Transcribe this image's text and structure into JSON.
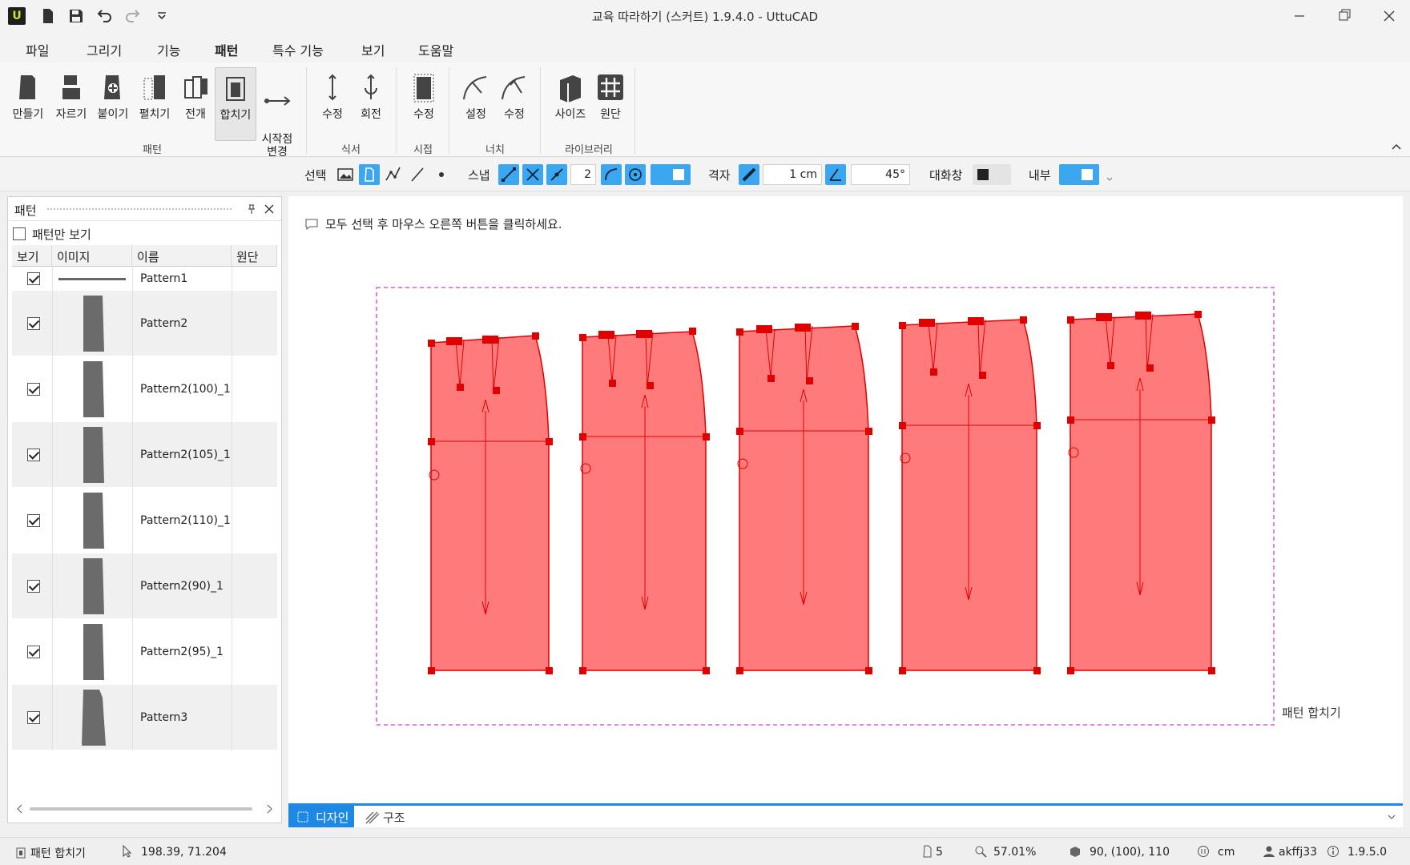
{
  "app": {
    "title": "교육 따라하기 (스커트) 1.9.4.0 - UttuCAD",
    "logo": "U"
  },
  "menu": [
    "파일",
    "그리기",
    "기능",
    "패턴",
    "특수 기능",
    "보기",
    "도움말"
  ],
  "ribbon": {
    "buttons": [
      "만들기",
      "자르기",
      "붙이기",
      "펼치기",
      "전개",
      "합치기",
      "시작점\n변경",
      "수정",
      "회전",
      "수정",
      "설정",
      "수정",
      "사이즈",
      "원단"
    ],
    "groups": [
      "패턴",
      "식서",
      "시접",
      "너치",
      "라이브러리"
    ]
  },
  "toolbar": {
    "select_label": "선택",
    "snap_label": "스냅",
    "snap_value": "2",
    "grid_label": "격자",
    "grid_value": "1 cm",
    "angle_value": "45°",
    "dialog_label": "대화창",
    "inner_label": "내부"
  },
  "panel": {
    "title": "패턴",
    "pattern_only_label": "패턴만 보기",
    "columns": [
      "보기",
      "이미지",
      "이름",
      "원단"
    ],
    "rows": [
      {
        "name": "Pattern1",
        "checked": true
      },
      {
        "name": "Pattern2",
        "checked": true
      },
      {
        "name": "Pattern2(100)_1",
        "checked": true
      },
      {
        "name": "Pattern2(105)_1",
        "checked": true
      },
      {
        "name": "Pattern2(110)_1",
        "checked": true
      },
      {
        "name": "Pattern2(90)_1",
        "checked": true
      },
      {
        "name": "Pattern2(95)_1",
        "checked": true
      },
      {
        "name": "Pattern3",
        "checked": true
      }
    ]
  },
  "canvas": {
    "hint": "모두 선택 후 마우스 오른쪽 버튼을 클릭하세요.",
    "combine_label": "패턴 합치기",
    "fill_color": "#ff7b7b",
    "line_color": "#e00000",
    "frame_color": "#e05ae0"
  },
  "bottom_tabs": {
    "design": "디자인",
    "structure": "구조"
  },
  "status": {
    "mode": "패턴 합치기",
    "coords": "198.39, 71.204",
    "pattern_count": "5",
    "zoom": "57.01%",
    "sizes": "90, (100), 110",
    "unit": "cm",
    "user": "akffj33",
    "version": "1.9.5.0"
  }
}
